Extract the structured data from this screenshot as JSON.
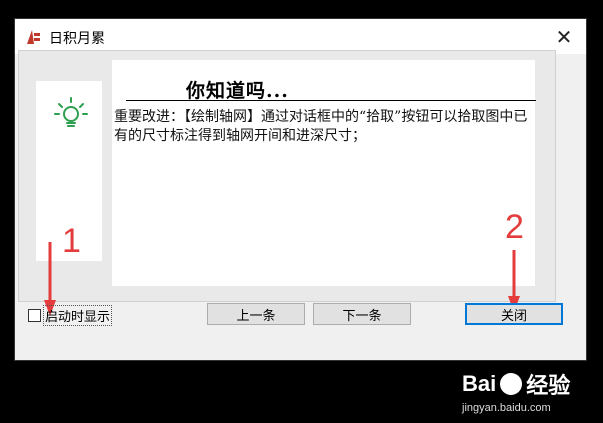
{
  "window": {
    "title": "日积月累",
    "close_glyph": "✕"
  },
  "tip": {
    "header": "你知道吗...",
    "body": "重要改进：【绘制轴网】通过对话框中的“拾取”按钮可以拾取图中已有的尺寸标注得到轴网开间和进深尺寸；"
  },
  "footer": {
    "show_on_startup_label": "启动时显示",
    "show_on_startup_checked": false,
    "prev_label": "上一条",
    "next_label": "下一条",
    "close_label": "关闭"
  },
  "annotations": {
    "marker_1": "1",
    "marker_2": "2",
    "color": "#e43c3c"
  },
  "watermark": {
    "brand": "Bai",
    "brand_suffix": "经验",
    "url": "jingyan.baidu.com"
  },
  "icons": {
    "app": "app-logo-icon",
    "bulb": "lightbulb-icon",
    "paw": "baidu-paw-icon"
  }
}
